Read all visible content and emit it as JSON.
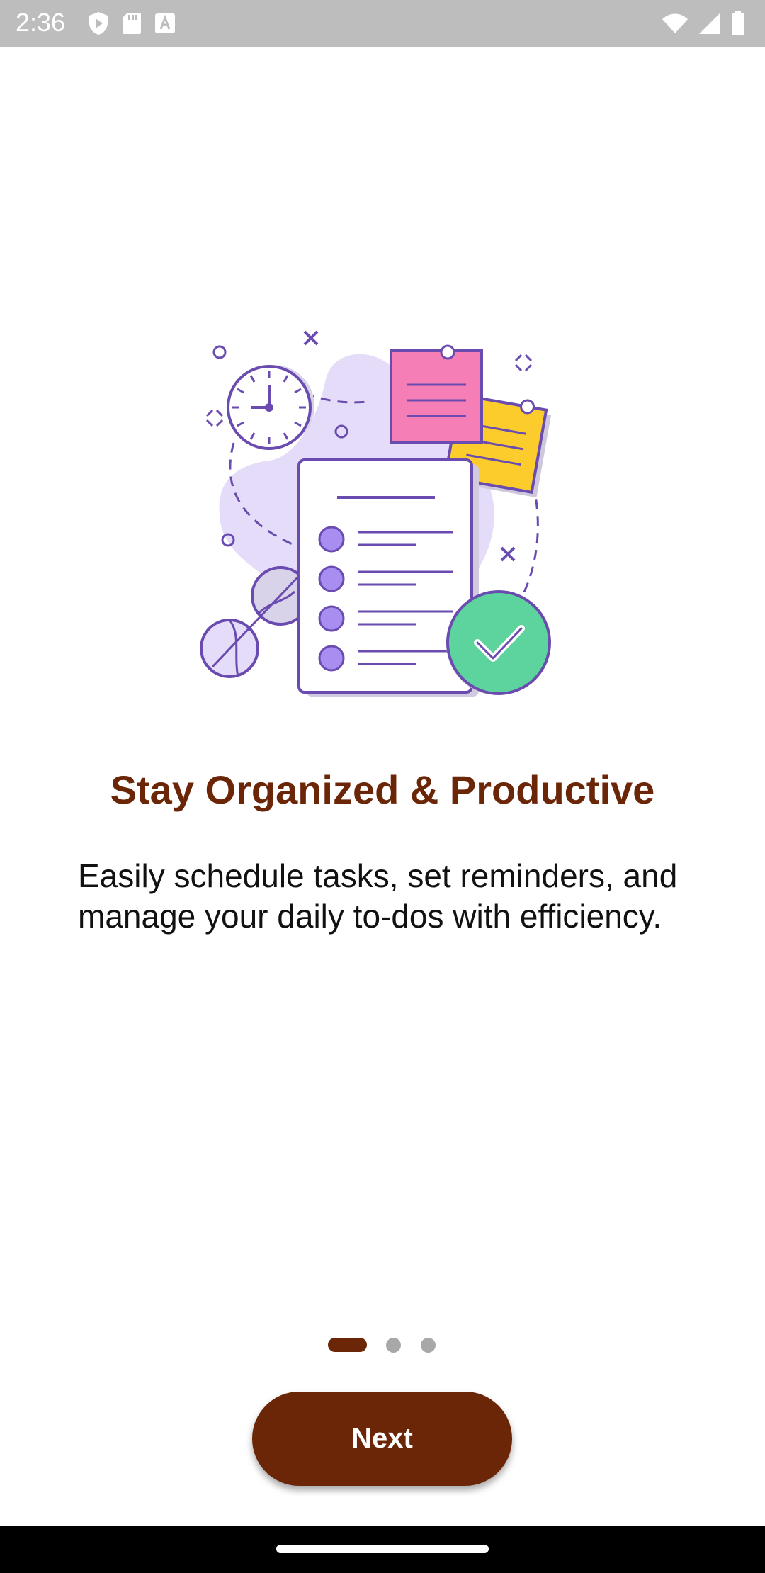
{
  "status_bar": {
    "time": "2:36",
    "left_icons": [
      "play-protect-icon",
      "sd-card-icon",
      "text-a-icon"
    ],
    "right_icons": [
      "wifi-icon",
      "signal-icon",
      "battery-icon"
    ]
  },
  "onboarding": {
    "illustration": "task-checklist-illustration",
    "title": "Stay Organized & Productive",
    "description": "Easily schedule tasks, set reminders, and manage your daily to-dos with efficiency.",
    "page_indicator": {
      "total_pages": 3,
      "current_page": 1
    },
    "next_label": "Next"
  },
  "colors": {
    "accent": "#6b2607",
    "status_bar": "#bdbdbd",
    "illustration_purple": "#6a4bb0",
    "illustration_lavender": "#e4dcf8",
    "note_pink": "#f57eb6",
    "note_yellow": "#fbcc2c",
    "check_green": "#5dd39e"
  }
}
